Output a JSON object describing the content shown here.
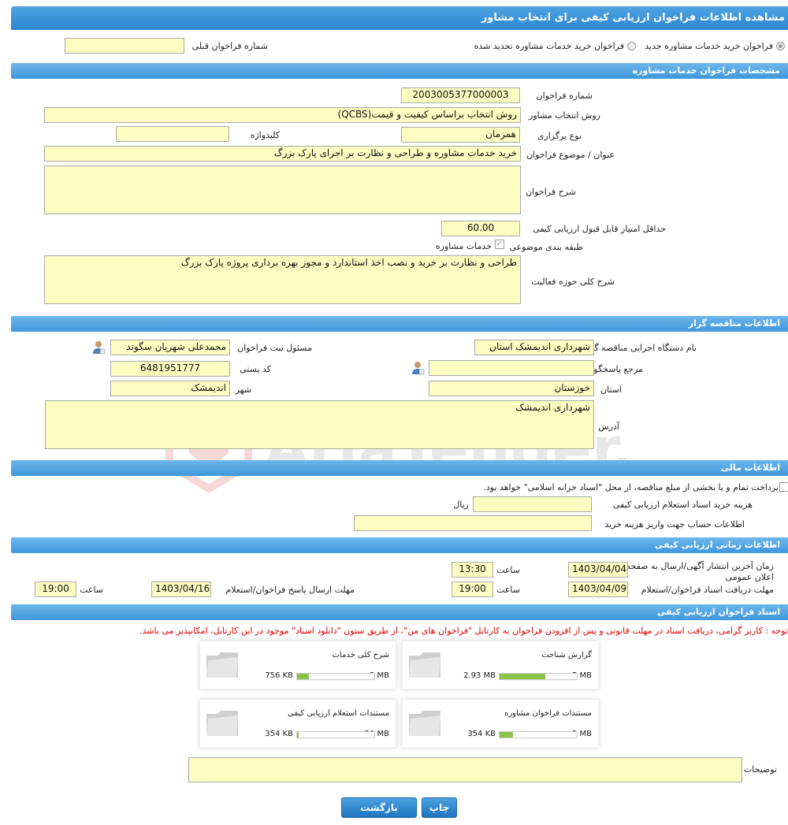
{
  "page_title": "مشاهده اطلاعات فراخوان ارزیابی کیفی برای انتخاب مشاور",
  "top": {
    "radio_new": "فراخوان خرید خدمات مشاوره جدید",
    "radio_renew": "فراخوان خرید خدمات مشاوره تجدید شده",
    "prev_call_label": "شماره فراخوان قبلی",
    "prev_call_value": ""
  },
  "sections": {
    "consulting": "مشخصات فراخوان خدمات مشاوره",
    "tenderer": "اطلاعات مناقصه گزار",
    "financial": "اطلاعات مالی",
    "timing": "اطلاعات زمانی ارزیابی کیفی",
    "documents": "اسناد فراخوان ارزیابی کیفی"
  },
  "consulting": {
    "call_number_label": "شماره فراخوان",
    "call_number": "2003005377000003",
    "method_label": "روش انتخاب مشاور",
    "method": "روش انتخاب براساس کیفیت و قیمت(QCBS)",
    "holding_type_label": "نوع برگزاری",
    "holding_type": "همزمان",
    "keyword_label": "کلیدواژه",
    "keyword": "",
    "subject_label": "عنوان / موضوع فراخوان",
    "subject": "خرید خدمات مشاوره و طراحی و نظارت بر اجرای پارک بزرگ",
    "description_label": "شرح فراخوان",
    "description": "",
    "min_score_label": "حداقل امتیاز قابل قبول ارزیابی کیفی",
    "min_score": "60.00",
    "category_label": "طبقه بندی موضوعی",
    "category_item": "خدمات مشاوره",
    "scope_label": "شرح کلی حوزه فعالیت",
    "scope": "طراحی و نظارت بر خرید و نصب اخذ استاندارد و مجوز بهره برداری پروژه پارک بزرگ"
  },
  "tenderer": {
    "org_label": "نام دستگاه اجرایی مناقصه گزار",
    "org": "شهرداری اندیمشک استان",
    "registrar_label": "مسئول ثبت فراخوان",
    "registrar": "محمدعلی شهریان سگوند",
    "responder_label": "مرجع پاسخگویی",
    "responder": "",
    "postal_label": "کد پستی",
    "postal": "6481951777",
    "province_label": "استان",
    "province": "خوزستان",
    "city_label": "شهر",
    "city": "اندیمشک",
    "address_label": "آدرس",
    "address": "شهرداری اندیمشک"
  },
  "financial": {
    "treasury_text": "پرداخت تمام و یا بخشی از مبلغ مناقصه، از محل \"اسناد خزانه اسلامی\" خواهد بود.",
    "doc_cost_label": "هزینه خرید اسناد استعلام ارزیابی کیفی",
    "doc_cost": "",
    "currency": "ریال",
    "account_label": "اطلاعات حساب جهت واریز هزینه خرید",
    "account": ""
  },
  "timing": {
    "publish_label": "زمان آخرین انتشار آگهی/ارسال به صفحه اعلان عمومی",
    "publish_date": "1403/04/04",
    "time_label": "ساعت",
    "publish_time": "13:30",
    "receive_label": "مهلت دریافت اسناد فراخوان/استعلام",
    "receive_date": "1403/04/09",
    "receive_time": "19:00",
    "reply_label": "مهلت ارسال پاسخ فراخوان/استعلام",
    "reply_date": "1403/04/16",
    "reply_time": "19:00"
  },
  "documents": {
    "notice": "توجه : کاربر گرامی، دریافت اسناد در مهلت قانونی و پس از افزودن فراخوان به کارتابل \"فراخوان های من\"، از طریق ستون \"دانلود اسناد\" موجود در این کارتابل، امکانپذیر می باشد.",
    "files": [
      {
        "name": "گزارش شناخت",
        "size": "2.93 MB",
        "max": "5 MB",
        "fraction": 0.586
      },
      {
        "name": "شرح کلی خدمات",
        "size": "756 KB",
        "max": "5 MB",
        "fraction": 0.15
      },
      {
        "name": "مستندات فراخوان مشاوره",
        "size": "354 KB",
        "max": "2 MB",
        "fraction": 0.17
      },
      {
        "name": "مستندات استعلام ارزیابی کیفی",
        "size": "354 KB",
        "max": "20 MB",
        "fraction": 0.02
      }
    ],
    "notes_label": "توضیحات",
    "notes": ""
  },
  "buttons": {
    "print": "چاپ",
    "back": "بازگشت"
  },
  "watermark": "AriaTender.neT",
  "icons": {
    "user": "user-icon",
    "folder": "folder-icon",
    "checkbox": "checkbox-icon"
  }
}
